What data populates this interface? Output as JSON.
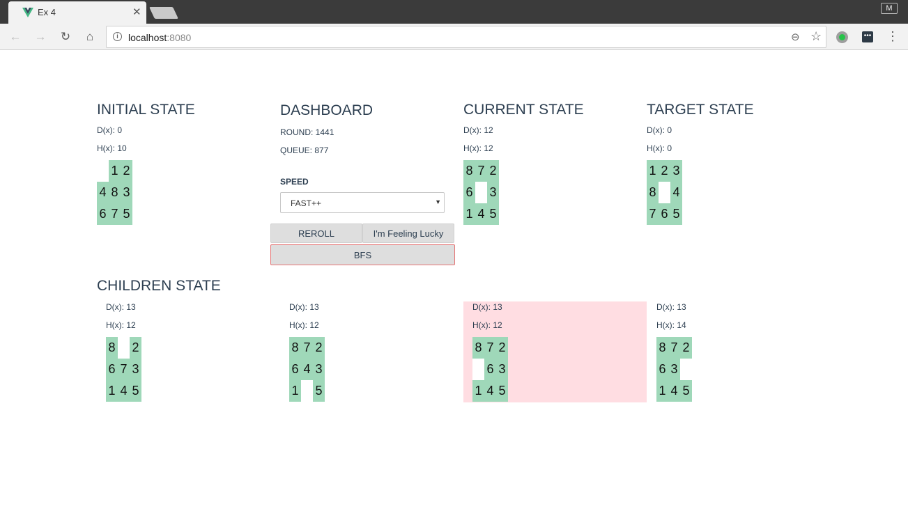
{
  "browser": {
    "tab_title": "Ex 4",
    "tab_close": "✕",
    "profile_initial": "M",
    "url_host": "localhost",
    "url_port": ":8080",
    "icons": [
      "back-icon",
      "forward-icon",
      "reload-icon",
      "home-icon",
      "info-icon",
      "zoom-out-icon",
      "star-icon",
      "extension-icon",
      "menu-icon"
    ]
  },
  "initial": {
    "title": "INITIAL STATE",
    "d": "D(x): 0",
    "h": "H(x): 10",
    "grid": [
      "",
      "1",
      "2",
      "4",
      "8",
      "3",
      "6",
      "7",
      "5"
    ]
  },
  "dashboard": {
    "title": "DASHBOARD",
    "round": "ROUND: 1441",
    "queue": "QUEUE: 877",
    "speed_label": "SPEED",
    "speed_value": "FAST++",
    "reroll": "REROLL",
    "lucky": "I'm Feeling Lucky",
    "bfs": "BFS"
  },
  "current": {
    "title": "CURRENT STATE",
    "d": "D(x): 12",
    "h": "H(x): 12",
    "grid": [
      "8",
      "7",
      "2",
      "6",
      "",
      "3",
      "1",
      "4",
      "5"
    ]
  },
  "target": {
    "title": "TARGET STATE",
    "d": "D(x): 0",
    "h": "H(x): 0",
    "grid": [
      "1",
      "2",
      "3",
      "8",
      "",
      "4",
      "7",
      "6",
      "5"
    ]
  },
  "children": {
    "title": "CHILDREN STATE",
    "highlight_color": "#ffdde2",
    "items": [
      {
        "d": "D(x): 13",
        "h": "H(x): 12",
        "grid": [
          "8",
          "",
          "2",
          "6",
          "7",
          "3",
          "1",
          "4",
          "5"
        ]
      },
      {
        "d": "D(x): 13",
        "h": "H(x): 12",
        "grid": [
          "8",
          "7",
          "2",
          "6",
          "4",
          "3",
          "1",
          "",
          "5"
        ]
      },
      {
        "d": "D(x): 13",
        "h": "H(x): 12",
        "grid": [
          "8",
          "7",
          "2",
          "",
          "6",
          "3",
          "1",
          "4",
          "5"
        ],
        "selected": true
      },
      {
        "d": "D(x): 13",
        "h": "H(x): 14",
        "grid": [
          "8",
          "7",
          "2",
          "6",
          "3",
          "",
          "1",
          "4",
          "5"
        ]
      }
    ]
  },
  "colors": {
    "tile": "#9fd8b9",
    "text": "#2c3e50",
    "bfs_border": "#e57373"
  }
}
